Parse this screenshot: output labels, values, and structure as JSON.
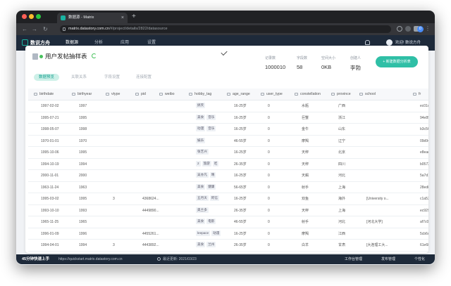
{
  "browser": {
    "tab_title": "数据源 - Matrix",
    "tab_close": "×",
    "new_tab": "+",
    "url_host": "matrix.datastory.com.cn",
    "url_path": "/#/project/details/2822/datasource",
    "back": "←",
    "forward": "→",
    "reload": "↻",
    "profile_initial": "D",
    "menu": "⋮"
  },
  "app": {
    "logo_text": "数说方舟",
    "nav": [
      "数据源",
      "分析",
      "应用",
      "设置"
    ],
    "active_nav": 0,
    "welcome": "欢迎! 数说方舟"
  },
  "datasource": {
    "title": "用户发帖抽样表",
    "stats": [
      {
        "label": "记录数",
        "value": "1000010"
      },
      {
        "label": "字段数",
        "value": "58"
      },
      {
        "label": "空间大小",
        "value": "0KB"
      },
      {
        "label": "创建人",
        "value": "李勃"
      }
    ],
    "create_button": "+ 新建数据分析表",
    "subtabs": [
      "数据预览",
      "关联关系",
      "字段设置",
      "连接配置"
    ],
    "active_subtab": 0
  },
  "table": {
    "columns": [
      "birthdate",
      "birthyear",
      "vtype",
      "pid",
      "weibo",
      "hobby_tag",
      "age_range",
      "user_type",
      "constellation",
      "province",
      "school",
      "fr"
    ],
    "rows": [
      {
        "birthdate": "1997-02-02",
        "birthyear": "1997",
        "vtype": "",
        "pid": "",
        "weibo": "",
        "hobby_tag": [
          "搞笑"
        ],
        "age_range": "16-25岁",
        "user_type": "0",
        "constellation": "水瓶",
        "province": "广西",
        "school": "",
        "fr": "ec01d43117fa31"
      },
      {
        "birthdate": "1995-07-21",
        "birthyear": "1995",
        "vtype": "",
        "pid": "",
        "weibo": "",
        "hobby_tag": [
          "美食",
          "音乐"
        ],
        "age_range": "16-25岁",
        "user_type": "0",
        "constellation": "巨蟹",
        "province": "浙江",
        "school": "",
        "fr": "94e898b1da480a"
      },
      {
        "birthdate": "1998-05-07",
        "birthyear": "1998",
        "vtype": "",
        "pid": "",
        "weibo": "",
        "hobby_tag": [
          "动漫",
          "音乐"
        ],
        "age_range": "16-25岁",
        "user_type": "0",
        "constellation": "金牛",
        "province": "山东",
        "school": "",
        "fr": "b3c56694a4a3b"
      },
      {
        "birthdate": "1970-01-01",
        "birthyear": "1970",
        "vtype": "",
        "pid": "",
        "weibo": "",
        "hobby_tag": [
          "娱乐"
        ],
        "age_range": "46-55岁",
        "user_type": "0",
        "constellation": "摩羯",
        "province": "辽宁",
        "school": "",
        "fr": "09d94423 1a19"
      },
      {
        "birthdate": "1995-10-06",
        "birthyear": "1995",
        "vtype": "",
        "pid": "",
        "weibo": "",
        "hobby_tag": [
          "张艺兴"
        ],
        "age_range": "16-25岁",
        "user_type": "0",
        "constellation": "天秤",
        "province": "北京",
        "school": "",
        "fr": "e8eaeaedc0d64"
      },
      {
        "birthdate": "1994-10-19",
        "birthyear": "1994",
        "vtype": "",
        "pid": "",
        "weibo": "",
        "hobby_tag": [
          "2",
          "旅游",
          "吃"
        ],
        "age_range": "26-35岁",
        "user_type": "0",
        "constellation": "天秤",
        "province": "四川",
        "school": "",
        "fr": "b0572bfd12235"
      },
      {
        "birthdate": "2000-11-01",
        "birthyear": "2000",
        "vtype": "",
        "pid": "",
        "weibo": "",
        "hobby_tag": [
          "吴亦凡",
          "晴"
        ],
        "age_range": "16-25岁",
        "user_type": "0",
        "constellation": "天蝎",
        "province": "河北",
        "school": "",
        "fr": "5a7d174c570d1"
      },
      {
        "birthdate": "1963-11-24",
        "birthyear": "1963",
        "vtype": "",
        "pid": "",
        "weibo": "",
        "hobby_tag": [
          "美食",
          "健康"
        ],
        "age_range": "56-65岁",
        "user_type": "0",
        "constellation": "射手",
        "province": "上海",
        "school": "",
        "fr": "28ed81fa44bba5"
      },
      {
        "birthdate": "1995-03-02",
        "birthyear": "1995",
        "vtype": "3",
        "pid": "4368624...",
        "weibo": "",
        "hobby_tag": [
          "五月天",
          "阿信"
        ],
        "age_range": "16-25岁",
        "user_type": "0",
        "constellation": "双鱼",
        "province": "海外",
        "school": "[University o...",
        "fr": "c1a52411d869a1"
      },
      {
        "birthdate": "1993-10-10",
        "birthyear": "1993",
        "vtype": "",
        "pid": "4449890...",
        "weibo": "",
        "hobby_tag": [
          "奥兰多"
        ],
        "age_range": "26-35岁",
        "user_type": "0",
        "constellation": "天秤",
        "province": "上海",
        "school": "",
        "fr": "ec929cda7b6b8b"
      },
      {
        "birthdate": "1965-11-25",
        "birthyear": "1965",
        "vtype": "",
        "pid": "",
        "weibo": "",
        "hobby_tag": [
          "美食",
          "电影"
        ],
        "age_range": "46-55岁",
        "user_type": "0",
        "constellation": "射手",
        "province": "河北",
        "school": "[河北大学]",
        "fr": "af7c0296b8c63"
      },
      {
        "birthdate": "1996-01-09",
        "birthyear": "1996",
        "vtype": "",
        "pid": "4455261...",
        "weibo": "",
        "hobby_tag": [
          "leepace",
          "动漫"
        ],
        "age_range": "16-25岁",
        "user_type": "0",
        "constellation": "摩羯",
        "province": "江西",
        "school": "",
        "fr": "5cb6d0f0be631c"
      },
      {
        "birthdate": "1994-04-01",
        "birthyear": "1994",
        "vtype": "3",
        "pid": "4443892...",
        "weibo": "",
        "hobby_tag": [
          "美食",
          "兰州"
        ],
        "age_range": "26-35岁",
        "user_type": "0",
        "constellation": "白羊",
        "province": "甘肃",
        "school": "[大连理工大...",
        "fr": "61e681badb608"
      }
    ]
  },
  "bottom": {
    "quick_title": "45分钟快速上手",
    "quick_url": "https://quickstart.matrix.datastory.com.cn",
    "update_time": "最近更新: 2021/03/23",
    "links": [
      "工作台管理",
      "发布管理",
      "个性化"
    ]
  },
  "colors": {
    "accent": "#2fbfa6",
    "header_bg": "#1e2a3a"
  }
}
